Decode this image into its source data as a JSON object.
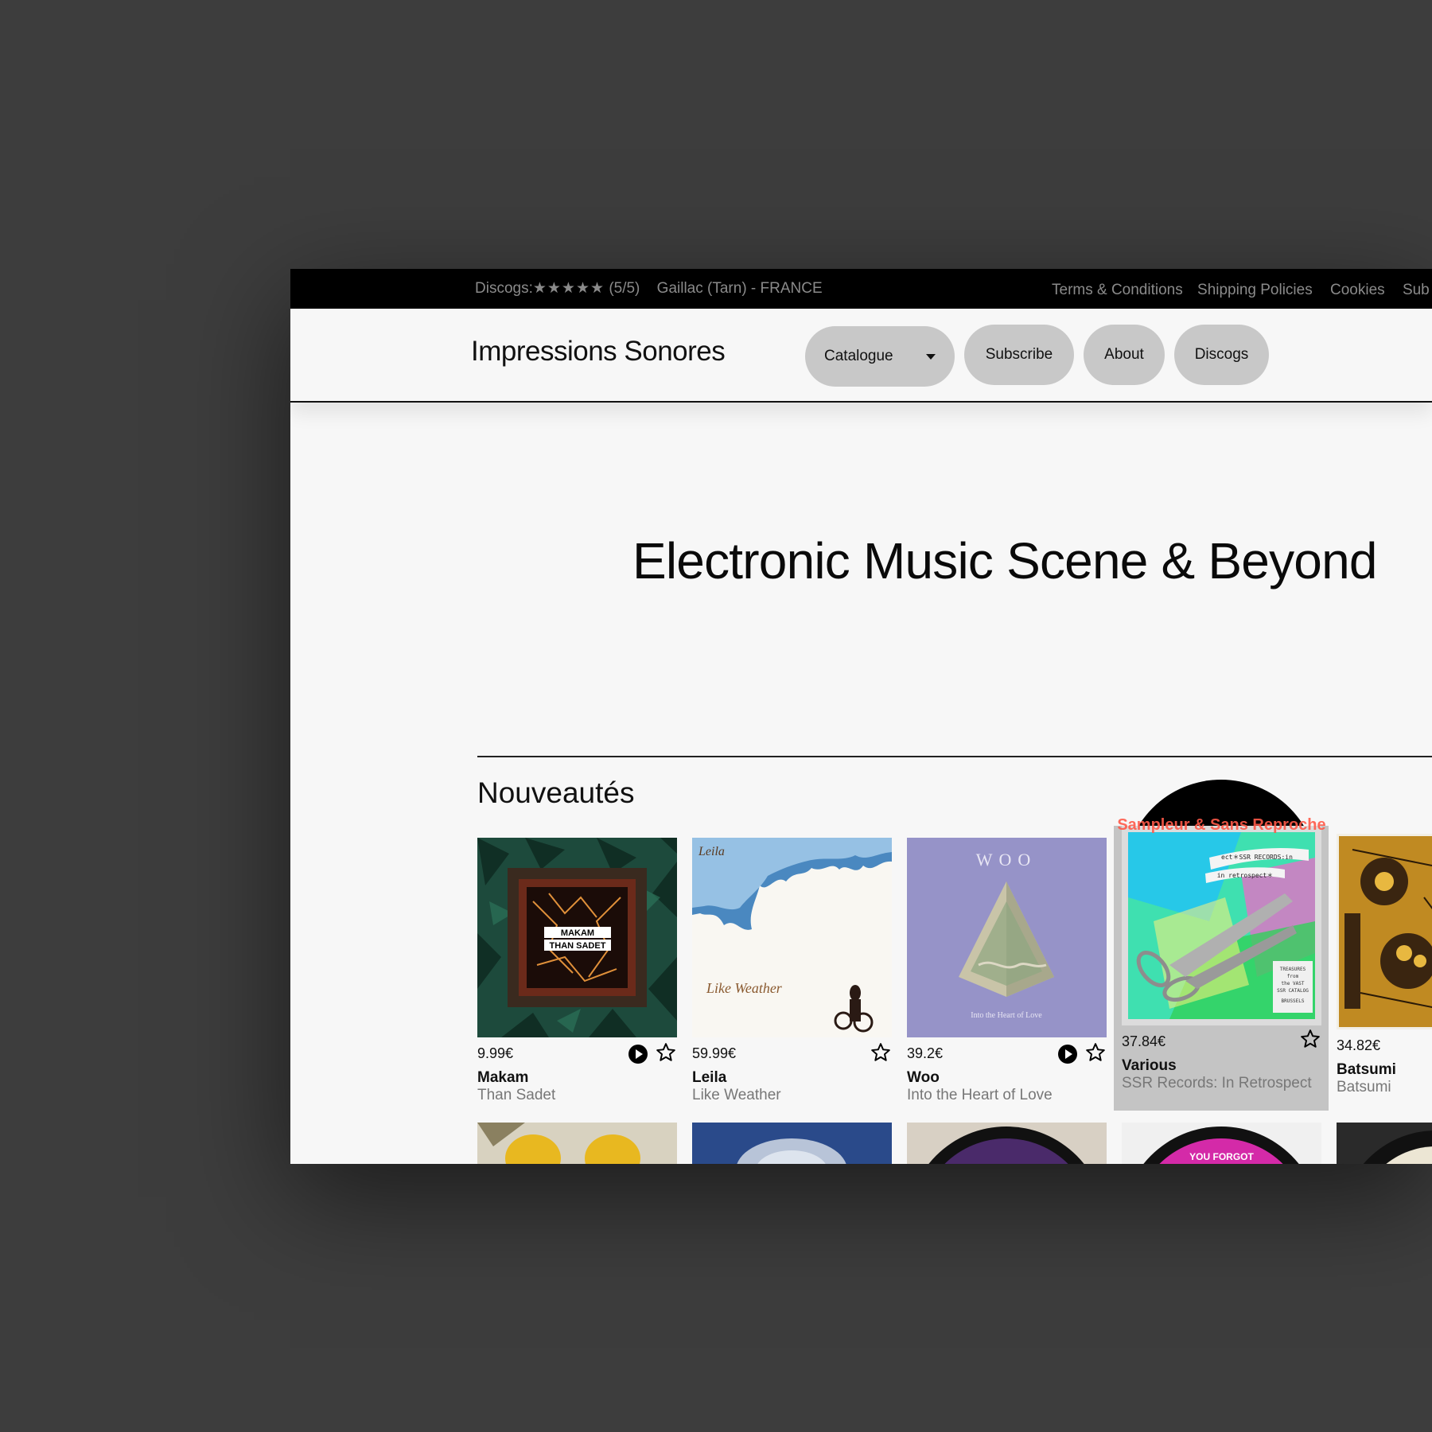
{
  "topbar": {
    "discogs_label": "Discogs:",
    "stars": "★★★★★",
    "rating": "(5/5)",
    "location": "Gaillac (Tarn) - FRANCE",
    "links": [
      "Terms & Conditions",
      "Shipping Policies",
      "Cookies",
      "Sub"
    ]
  },
  "header": {
    "logo": "Impressions Sonores",
    "nav": {
      "catalogue": "Catalogue",
      "subscribe": "Subscribe",
      "about": "About",
      "discogs": "Discogs"
    }
  },
  "hero": {
    "title": "Electronic Music Scene & Beyond"
  },
  "section": {
    "title": "Nouveautés"
  },
  "products": [
    {
      "price": "9.99€",
      "title": "Makam",
      "subtitle": "Than Sadet",
      "cover_text": "MAKAM\nTHAN SADET",
      "has_play": true
    },
    {
      "price": "59.99€",
      "title": "Leila",
      "subtitle": "Like Weather",
      "cover_text": "Leila",
      "cover_text2": "Like Weather",
      "has_play": false
    },
    {
      "price": "39.2€",
      "title": "Woo",
      "subtitle": "Into the Heart of Love",
      "cover_text": "WOO",
      "cover_text2": "Into the Heart of Love",
      "has_play": true
    },
    {
      "price": "37.84€",
      "title": "Various",
      "subtitle": "SSR Records: In Retrospect",
      "cover_text": "Sampleur & Sans Reproche",
      "has_play": false
    },
    {
      "price": "34.82€",
      "title": "Batsumi",
      "subtitle": "Batsumi",
      "has_play": false
    }
  ],
  "row2": {
    "label": "YOU FORGOT"
  },
  "colors": {
    "background": "#3d3d3d",
    "topbar": "#000000",
    "page": "#f7f7f7",
    "pill": "#c8c8c8",
    "hover_card": "#c4c4c4",
    "muted_text": "#777777"
  }
}
